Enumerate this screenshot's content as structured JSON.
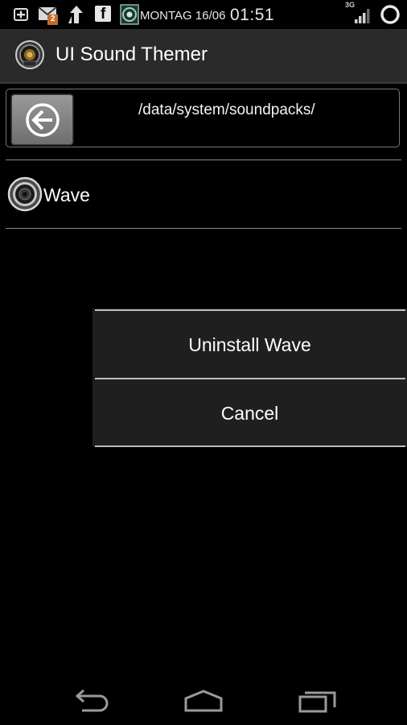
{
  "status_bar": {
    "date": "MONTAG 16/06",
    "time": "01:51",
    "network": "3G",
    "mail_count": "2",
    "icons": [
      "add-box-icon",
      "gmail-icon",
      "upload-icon",
      "facebook-icon",
      "app-notification-icon",
      "signal-icon",
      "circle-status-icon"
    ]
  },
  "action_bar": {
    "title": "UI Sound Themer",
    "icon": "speaker-app-icon"
  },
  "path_bar": {
    "path": "/data/system/soundpacks/",
    "back_icon": "back-arrow-icon"
  },
  "list": {
    "items": [
      {
        "label": "Wave",
        "icon": "speaker-icon"
      }
    ]
  },
  "context_menu": {
    "items": [
      {
        "label": "Uninstall Wave"
      },
      {
        "label": "Cancel"
      }
    ]
  },
  "nav_bar": {
    "icons": [
      "nav-back-icon",
      "nav-home-icon",
      "nav-recents-icon"
    ]
  },
  "colors": {
    "background": "#000000",
    "action_bar": "#2a2a2a",
    "menu_background": "#1f1f1f",
    "divider": "#8a8a8a",
    "text": "#ffffff"
  }
}
